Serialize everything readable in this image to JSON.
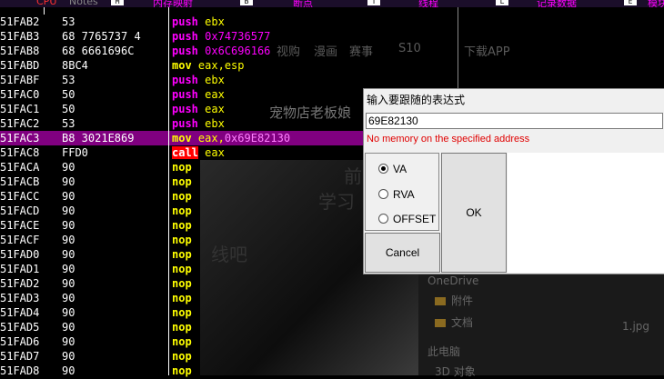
{
  "topbar": {
    "items": [
      {
        "key": "",
        "label": "CPU"
      },
      {
        "key": "",
        "label": "Notes"
      },
      {
        "key": "M",
        "label": "内存映射"
      },
      {
        "key": "B",
        "label": "断点"
      },
      {
        "key": "T",
        "label": "线程"
      },
      {
        "key": "L",
        "label": "记录数据"
      },
      {
        "key": "E",
        "label": "模块"
      }
    ]
  },
  "disasm": {
    "rows": [
      {
        "addr": "51FAB2",
        "bytes": "53",
        "op": "push",
        "args": "ebx",
        "args_kind": "reg"
      },
      {
        "addr": "51FAB3",
        "bytes": "68 7765737 4",
        "op": "push",
        "args": "0x74736577",
        "args_kind": "imm"
      },
      {
        "addr": "51FAB8",
        "bytes": "68 6661696C",
        "op": "push",
        "args": "0x6C696166",
        "args_kind": "imm"
      },
      {
        "addr": "51FABD",
        "bytes": "8BC4",
        "op": "mov",
        "args": "eax,esp",
        "args_kind": "reg"
      },
      {
        "addr": "51FABF",
        "bytes": "53",
        "op": "push",
        "args": "ebx",
        "args_kind": "reg"
      },
      {
        "addr": "51FAC0",
        "bytes": "50",
        "op": "push",
        "args": "eax",
        "args_kind": "reg"
      },
      {
        "addr": "51FAC1",
        "bytes": "50",
        "op": "push",
        "args": "eax",
        "args_kind": "reg"
      },
      {
        "addr": "51FAC2",
        "bytes": "53",
        "op": "push",
        "args": "ebx",
        "args_kind": "reg"
      },
      {
        "addr": "51FAC3",
        "bytes": "B8 3021E869",
        "op": "mov",
        "args": "eax,0x69E82130",
        "args_kind": "mixed",
        "highlight": true
      },
      {
        "addr": "51FAC8",
        "bytes": "FFD0",
        "op": "call",
        "args": "eax",
        "args_kind": "reg"
      },
      {
        "addr": "51FACA",
        "bytes": "90",
        "op": "nop",
        "args": "",
        "args_kind": "none"
      },
      {
        "addr": "51FACB",
        "bytes": "90",
        "op": "nop",
        "args": "",
        "args_kind": "none"
      },
      {
        "addr": "51FACC",
        "bytes": "90",
        "op": "nop",
        "args": "",
        "args_kind": "none"
      },
      {
        "addr": "51FACD",
        "bytes": "90",
        "op": "nop",
        "args": "",
        "args_kind": "none"
      },
      {
        "addr": "51FACE",
        "bytes": "90",
        "op": "nop",
        "args": "",
        "args_kind": "none"
      },
      {
        "addr": "51FACF",
        "bytes": "90",
        "op": "nop",
        "args": "",
        "args_kind": "none"
      },
      {
        "addr": "51FAD0",
        "bytes": "90",
        "op": "nop",
        "args": "",
        "args_kind": "none"
      },
      {
        "addr": "51FAD1",
        "bytes": "90",
        "op": "nop",
        "args": "",
        "args_kind": "none"
      },
      {
        "addr": "51FAD2",
        "bytes": "90",
        "op": "nop",
        "args": "",
        "args_kind": "none"
      },
      {
        "addr": "51FAD3",
        "bytes": "90",
        "op": "nop",
        "args": "",
        "args_kind": "none"
      },
      {
        "addr": "51FAD4",
        "bytes": "90",
        "op": "nop",
        "args": "",
        "args_kind": "none"
      },
      {
        "addr": "51FAD5",
        "bytes": "90",
        "op": "nop",
        "args": "",
        "args_kind": "none"
      },
      {
        "addr": "51FAD6",
        "bytes": "90",
        "op": "nop",
        "args": "",
        "args_kind": "none"
      },
      {
        "addr": "51FAD7",
        "bytes": "90",
        "op": "nop",
        "args": "",
        "args_kind": "none"
      },
      {
        "addr": "51FAD8",
        "bytes": "90",
        "op": "nop",
        "args": "",
        "args_kind": "none"
      }
    ]
  },
  "background": {
    "ghost_items": [
      "视购",
      "漫画",
      "赛事",
      "S10",
      "下载APP"
    ],
    "shop_text": "宠物店老板娘",
    "photo_text_1": "前",
    "photo_text_2": "学习",
    "photo_text_3": "线吧",
    "file_name": "1.jpg",
    "explorer_items": [
      "OneDrive",
      "附件",
      "文档",
      "此电脑",
      "3D 对象"
    ]
  },
  "dialog": {
    "title": "输入要跟随的表达式",
    "input_value": "69E82130",
    "error": "No memory on the specified address",
    "radios": [
      {
        "label": "VA",
        "checked": true
      },
      {
        "label": "RVA",
        "checked": false
      },
      {
        "label": "OFFSET",
        "checked": false
      }
    ],
    "ok_label": "OK",
    "cancel_label": "Cancel"
  }
}
